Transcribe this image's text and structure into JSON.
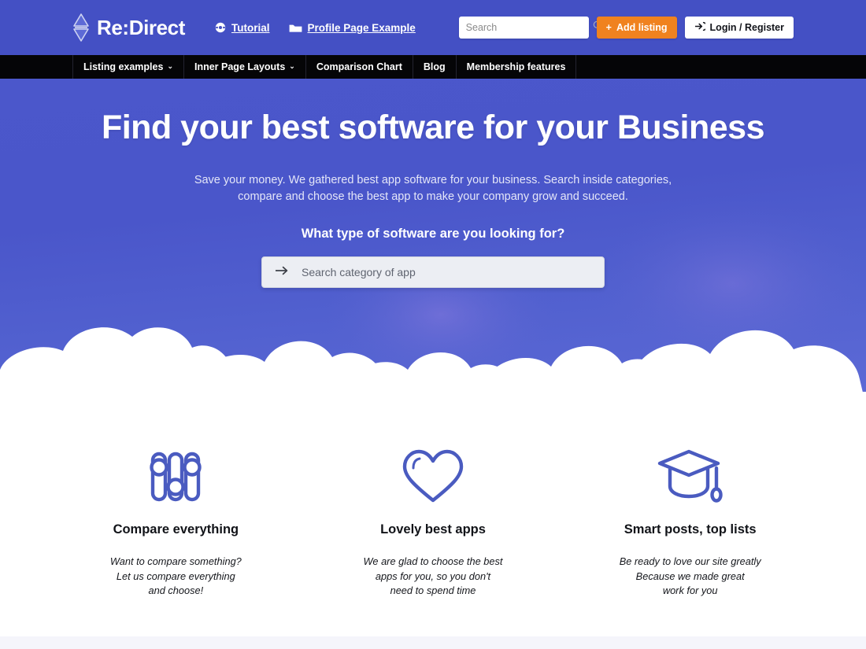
{
  "header": {
    "logo_text": "Re:Direct",
    "logo_icon": "diamond-arrow-icon",
    "links": [
      {
        "label": "Tutorial",
        "icon": "tutorial-disc-icon"
      },
      {
        "label": "Profile Page Example",
        "icon": "folder-icon"
      }
    ],
    "search": {
      "value": "",
      "placeholder": "Search",
      "icon": "search-icon"
    },
    "add_listing_label": "Add listing",
    "add_listing_plus": "+",
    "login_label": "Login / Register",
    "login_icon": "login-arrow-icon",
    "bg_color": "#4450c4",
    "accent_orange": "#f0821f"
  },
  "nav": {
    "bg_color": "#050507",
    "items": [
      {
        "label": "Listing examples",
        "caret": "⌄"
      },
      {
        "label": "Inner Page Layouts",
        "caret": "⌄"
      },
      {
        "label": "Comparison Chart",
        "caret": ""
      },
      {
        "label": "Blog",
        "caret": ""
      },
      {
        "label": "Membership features",
        "caret": ""
      }
    ]
  },
  "hero": {
    "title": "Find your best software for your Business",
    "subtitle_line1": "Save your money. We gathered best app software for your business. Search inside categories,",
    "subtitle_line2": "compare and choose the best app to make your company grow and succeed.",
    "question": "What type of software are you looking for?",
    "category_search": {
      "value": "",
      "placeholder": "Search category of app",
      "icon": "arrow-right-icon"
    },
    "bg_color": "#4b57cb"
  },
  "features": [
    {
      "icon": "sliders-icon",
      "title": "Compare everything",
      "desc_line1": "Want to compare something?",
      "desc_line2": "Let us compare everything",
      "desc_line3": "and choose!"
    },
    {
      "icon": "heart-icon",
      "title": "Lovely best apps",
      "desc_line1": "We are glad to choose the best",
      "desc_line2": "apps for you, so you don't",
      "desc_line3": "need to spend time"
    },
    {
      "icon": "graduation-cap-icon",
      "title": "Smart posts, top lists",
      "desc_line1": "Be ready to love our site greatly",
      "desc_line2": "Because we made great",
      "desc_line3": "work for you"
    }
  ],
  "icon_color": "#4a5bc0"
}
